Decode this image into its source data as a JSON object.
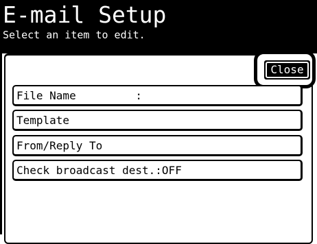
{
  "header": {
    "title": "E-mail Setup",
    "subtitle": "Select an item to edit."
  },
  "close_button": {
    "label": "Close"
  },
  "menu": {
    "items": [
      {
        "label": "File Name         :"
      },
      {
        "label": "Template"
      },
      {
        "label": "From/Reply To"
      },
      {
        "label": "Check broadcast dest.:OFF"
      }
    ]
  },
  "colors": {
    "header_bg": "#000000",
    "header_text": "#ffffff",
    "background": "#ffffff",
    "border": "#000000"
  }
}
